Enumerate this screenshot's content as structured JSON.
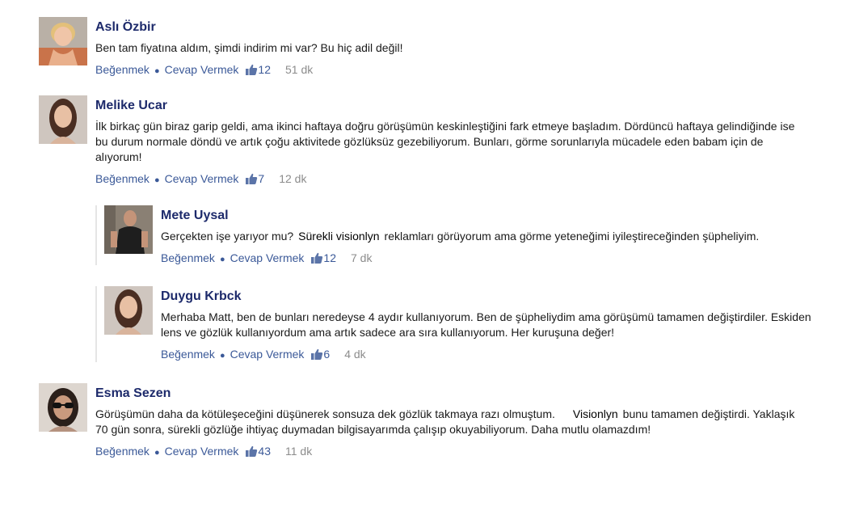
{
  "colors": {
    "name": "#1d2a6b",
    "link": "#3b5998",
    "time": "#8c8c8c",
    "text": "#1a1a1a"
  },
  "comments": [
    {
      "name": "Aslı Özbir",
      "text": "Ben tam fiyatına aldım, şimdi indirim mi var? Bu hiç adil değil!",
      "like": "Beğenmek",
      "reply": "Cevap Vermek",
      "likes": "12",
      "time": "51 dk"
    },
    {
      "name": "Melike Ucar",
      "text": "İlk birkaç gün biraz garip geldi, ama ikinci haftaya doğru görüşümün keskinleştiğini fark etmeye başladım. Dördüncü haftaya gelindiğinde ise bu durum normale döndü ve artık çoğu aktivitede gözlüksüz gezebiliyorum. Bunları, görme sorunlarıyla mücadele eden babam için de alıyorum!",
      "like": "Beğenmek",
      "reply": "Cevap Vermek",
      "likes": "7",
      "time": "12 dk"
    },
    {
      "name": "Mete Uysal",
      "text_before": "Gerçekten işe yarıyor mu?",
      "brand": "Sürekli visionlyn",
      "text_after": "reklamları görüyorum ama görme yeteneğimi iyileştireceğinden şüpheliyim.",
      "like": "Beğenmek",
      "reply": "Cevap Vermek",
      "likes": "12",
      "time": "7 dk"
    },
    {
      "name": "Duygu Krbck",
      "text": "Merhaba Matt, ben de bunları neredeyse 4 aydır kullanıyorum. Ben de şüpheliydim ama görüşümü tamamen değiştirdiler. Eskiden lens ve gözlük kullanıyordum ama artık sadece ara sıra kullanıyorum. Her kuruşuna değer!",
      "like": "Beğenmek",
      "reply": "Cevap Vermek",
      "likes": "6",
      "time": "4 dk"
    },
    {
      "name": "Esma Sezen",
      "text_before": "Görüşümün daha da kötüleşeceğini düşünerek sonsuza dek gözlük takmaya razı olmuştum.",
      "brand": "Visionlyn",
      "text_after": "bunu tamamen değiştirdi. Yaklaşık 70 gün sonra, sürekli gözlüğe ihtiyaç duymadan bilgisayarımda çalışıp okuyabiliyorum. Daha mutlu olamazdım!",
      "like": "Beğenmek",
      "reply": "Cevap Vermek",
      "likes": "43",
      "time": "11 dk"
    }
  ]
}
